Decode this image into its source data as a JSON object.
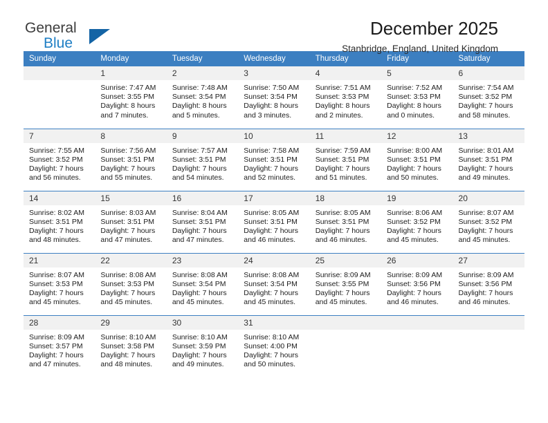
{
  "brand": {
    "name_part1": "General",
    "name_part2": "Blue",
    "flag_icon": "blue-triangle-flag-icon",
    "accent_color": "#1d7ec4"
  },
  "header": {
    "title": "December 2025",
    "subtitle": "Stanbridge, England, United Kingdom"
  },
  "calendar": {
    "header_bg": "#3c7fc1",
    "daynum_bg": "#f1f1f1",
    "weekday_headers": [
      "Sunday",
      "Monday",
      "Tuesday",
      "Wednesday",
      "Thursday",
      "Friday",
      "Saturday"
    ],
    "weeks": [
      [
        {
          "day": "",
          "lines": []
        },
        {
          "day": "1",
          "lines": [
            "Sunrise: 7:47 AM",
            "Sunset: 3:55 PM",
            "Daylight: 8 hours",
            "and 7 minutes."
          ]
        },
        {
          "day": "2",
          "lines": [
            "Sunrise: 7:48 AM",
            "Sunset: 3:54 PM",
            "Daylight: 8 hours",
            "and 5 minutes."
          ]
        },
        {
          "day": "3",
          "lines": [
            "Sunrise: 7:50 AM",
            "Sunset: 3:54 PM",
            "Daylight: 8 hours",
            "and 3 minutes."
          ]
        },
        {
          "day": "4",
          "lines": [
            "Sunrise: 7:51 AM",
            "Sunset: 3:53 PM",
            "Daylight: 8 hours",
            "and 2 minutes."
          ]
        },
        {
          "day": "5",
          "lines": [
            "Sunrise: 7:52 AM",
            "Sunset: 3:53 PM",
            "Daylight: 8 hours",
            "and 0 minutes."
          ]
        },
        {
          "day": "6",
          "lines": [
            "Sunrise: 7:54 AM",
            "Sunset: 3:52 PM",
            "Daylight: 7 hours",
            "and 58 minutes."
          ]
        }
      ],
      [
        {
          "day": "7",
          "lines": [
            "Sunrise: 7:55 AM",
            "Sunset: 3:52 PM",
            "Daylight: 7 hours",
            "and 56 minutes."
          ]
        },
        {
          "day": "8",
          "lines": [
            "Sunrise: 7:56 AM",
            "Sunset: 3:51 PM",
            "Daylight: 7 hours",
            "and 55 minutes."
          ]
        },
        {
          "day": "9",
          "lines": [
            "Sunrise: 7:57 AM",
            "Sunset: 3:51 PM",
            "Daylight: 7 hours",
            "and 54 minutes."
          ]
        },
        {
          "day": "10",
          "lines": [
            "Sunrise: 7:58 AM",
            "Sunset: 3:51 PM",
            "Daylight: 7 hours",
            "and 52 minutes."
          ]
        },
        {
          "day": "11",
          "lines": [
            "Sunrise: 7:59 AM",
            "Sunset: 3:51 PM",
            "Daylight: 7 hours",
            "and 51 minutes."
          ]
        },
        {
          "day": "12",
          "lines": [
            "Sunrise: 8:00 AM",
            "Sunset: 3:51 PM",
            "Daylight: 7 hours",
            "and 50 minutes."
          ]
        },
        {
          "day": "13",
          "lines": [
            "Sunrise: 8:01 AM",
            "Sunset: 3:51 PM",
            "Daylight: 7 hours",
            "and 49 minutes."
          ]
        }
      ],
      [
        {
          "day": "14",
          "lines": [
            "Sunrise: 8:02 AM",
            "Sunset: 3:51 PM",
            "Daylight: 7 hours",
            "and 48 minutes."
          ]
        },
        {
          "day": "15",
          "lines": [
            "Sunrise: 8:03 AM",
            "Sunset: 3:51 PM",
            "Daylight: 7 hours",
            "and 47 minutes."
          ]
        },
        {
          "day": "16",
          "lines": [
            "Sunrise: 8:04 AM",
            "Sunset: 3:51 PM",
            "Daylight: 7 hours",
            "and 47 minutes."
          ]
        },
        {
          "day": "17",
          "lines": [
            "Sunrise: 8:05 AM",
            "Sunset: 3:51 PM",
            "Daylight: 7 hours",
            "and 46 minutes."
          ]
        },
        {
          "day": "18",
          "lines": [
            "Sunrise: 8:05 AM",
            "Sunset: 3:51 PM",
            "Daylight: 7 hours",
            "and 46 minutes."
          ]
        },
        {
          "day": "19",
          "lines": [
            "Sunrise: 8:06 AM",
            "Sunset: 3:52 PM",
            "Daylight: 7 hours",
            "and 45 minutes."
          ]
        },
        {
          "day": "20",
          "lines": [
            "Sunrise: 8:07 AM",
            "Sunset: 3:52 PM",
            "Daylight: 7 hours",
            "and 45 minutes."
          ]
        }
      ],
      [
        {
          "day": "21",
          "lines": [
            "Sunrise: 8:07 AM",
            "Sunset: 3:53 PM",
            "Daylight: 7 hours",
            "and 45 minutes."
          ]
        },
        {
          "day": "22",
          "lines": [
            "Sunrise: 8:08 AM",
            "Sunset: 3:53 PM",
            "Daylight: 7 hours",
            "and 45 minutes."
          ]
        },
        {
          "day": "23",
          "lines": [
            "Sunrise: 8:08 AM",
            "Sunset: 3:54 PM",
            "Daylight: 7 hours",
            "and 45 minutes."
          ]
        },
        {
          "day": "24",
          "lines": [
            "Sunrise: 8:08 AM",
            "Sunset: 3:54 PM",
            "Daylight: 7 hours",
            "and 45 minutes."
          ]
        },
        {
          "day": "25",
          "lines": [
            "Sunrise: 8:09 AM",
            "Sunset: 3:55 PM",
            "Daylight: 7 hours",
            "and 45 minutes."
          ]
        },
        {
          "day": "26",
          "lines": [
            "Sunrise: 8:09 AM",
            "Sunset: 3:56 PM",
            "Daylight: 7 hours",
            "and 46 minutes."
          ]
        },
        {
          "day": "27",
          "lines": [
            "Sunrise: 8:09 AM",
            "Sunset: 3:56 PM",
            "Daylight: 7 hours",
            "and 46 minutes."
          ]
        }
      ],
      [
        {
          "day": "28",
          "lines": [
            "Sunrise: 8:09 AM",
            "Sunset: 3:57 PM",
            "Daylight: 7 hours",
            "and 47 minutes."
          ]
        },
        {
          "day": "29",
          "lines": [
            "Sunrise: 8:10 AM",
            "Sunset: 3:58 PM",
            "Daylight: 7 hours",
            "and 48 minutes."
          ]
        },
        {
          "day": "30",
          "lines": [
            "Sunrise: 8:10 AM",
            "Sunset: 3:59 PM",
            "Daylight: 7 hours",
            "and 49 minutes."
          ]
        },
        {
          "day": "31",
          "lines": [
            "Sunrise: 8:10 AM",
            "Sunset: 4:00 PM",
            "Daylight: 7 hours",
            "and 50 minutes."
          ]
        },
        {
          "day": "",
          "lines": []
        },
        {
          "day": "",
          "lines": []
        },
        {
          "day": "",
          "lines": []
        }
      ]
    ]
  }
}
